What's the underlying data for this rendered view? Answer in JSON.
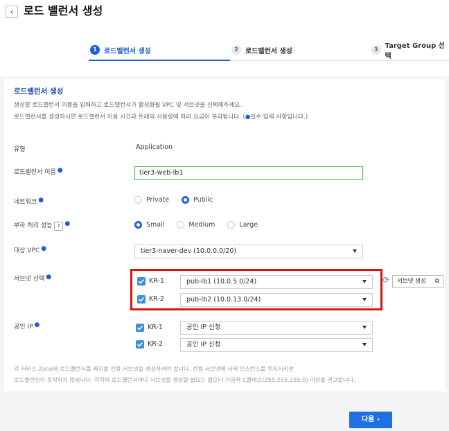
{
  "header": {
    "back_icon": "chevron-left-icon",
    "title": "로드 밸런서 생성"
  },
  "steps": [
    {
      "num": "1",
      "label": "로드밸런서 생성",
      "active": true
    },
    {
      "num": "2",
      "label": "로드밸런서 생성",
      "active": false
    },
    {
      "num": "3",
      "label": "Target Group 선택",
      "active": false
    }
  ],
  "section": {
    "title": "로드밸런서 생성",
    "desc1": "생성할 로드밸런서 이름을 입력하고 로드밸런서가 활성화될 VPC 및 서브넷을 선택해주세요.",
    "desc2_pre": "로드밸런서를 생성하시면 로드밸런서 이용 시간과 트래픽 사용량에 따라 요금이 부과됩니다. (",
    "desc2_dot": "●",
    "desc2_post": "필수 입력 사항입니다.)"
  },
  "form": {
    "type_label": "유형",
    "type_value": "Application",
    "name_label": "로드밸런서 이름",
    "name_value": "tier3-web-lb1",
    "network_label": "네트워크",
    "network_options": [
      "Private",
      "Public"
    ],
    "network_selected": "Public",
    "perf_label": "부하 처리 성능",
    "perf_help": "?",
    "perf_options": [
      "Small",
      "Medium",
      "Large"
    ],
    "perf_selected": "Small",
    "vpc_label": "대상 VPC",
    "vpc_value": "tier3-naver-dev (10.0.0.0/20)",
    "subnet_label": "서브넷 선택",
    "subnets": [
      {
        "zone": "KR-1",
        "value": "pub-lb1 (10.0.5.0/24)"
      },
      {
        "zone": "KR-2",
        "value": "pub-lb2 (10.0.13.0/24)"
      }
    ],
    "subnet_create_label": "서브넷 생성",
    "public_ip_label": "공인 IP",
    "public_ips": [
      {
        "zone": "KR-1",
        "value": "공인 IP 신청"
      },
      {
        "zone": "KR-2",
        "value": "공인 IP 신청"
      }
    ],
    "required_mark": "●"
  },
  "footnote": {
    "line1": "각 서비스 Zone에 로드밸런서를 배치할 전용 서브넷을 생성하셔야 합니다. 전용 서브넷에 서버 인스턴스를 위치시키면",
    "line2": "로드밸런싱이 동작하지 않습니다. 각각의 로드밸런서마다 서브넷을 생성할 필요는 없으나 가급적 C클래스(255.255.255.0) 이상을 권고합니다."
  },
  "next_button": "다음",
  "next_icon": "chevron-right-icon",
  "colors": {
    "accent": "#1f5fd6",
    "highlight": "#e01010",
    "checkbox": "#3d8fd8"
  }
}
